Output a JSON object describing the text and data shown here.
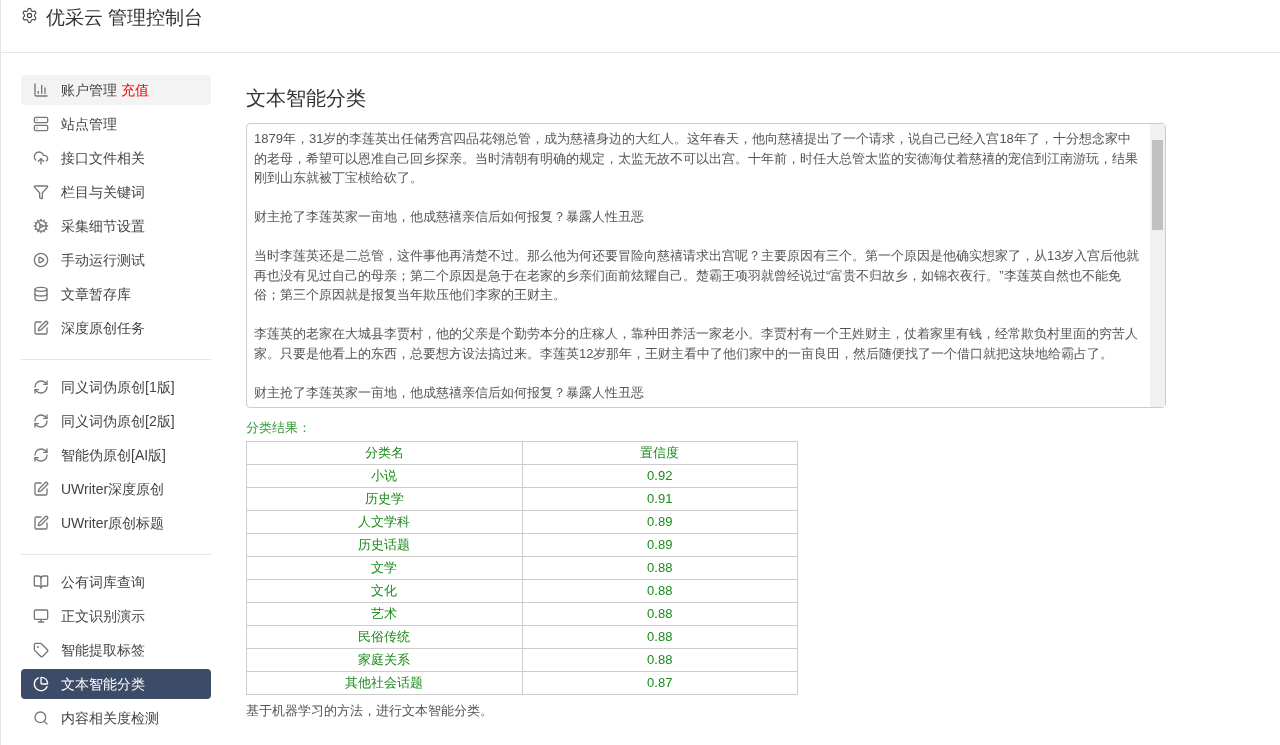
{
  "header": {
    "title": "优采云 管理控制台"
  },
  "sidebar": {
    "groups": [
      {
        "items": [
          {
            "label": "账户管理",
            "badge": "充值",
            "hovered": true,
            "selected": false
          },
          {
            "label": "站点管理",
            "hovered": false,
            "selected": false
          },
          {
            "label": "接口文件相关",
            "hovered": false,
            "selected": false
          },
          {
            "label": "栏目与关键词",
            "hovered": false,
            "selected": false
          },
          {
            "label": "采集细节设置",
            "hovered": false,
            "selected": false
          },
          {
            "label": "手动运行测试",
            "hovered": false,
            "selected": false
          },
          {
            "label": "文章暂存库",
            "hovered": false,
            "selected": false
          },
          {
            "label": "深度原创任务",
            "hovered": false,
            "selected": false
          }
        ]
      },
      {
        "items": [
          {
            "label": "同义词伪原创[1版]",
            "hovered": false,
            "selected": false
          },
          {
            "label": "同义词伪原创[2版]",
            "hovered": false,
            "selected": false
          },
          {
            "label": "智能伪原创[AI版]",
            "hovered": false,
            "selected": false
          },
          {
            "label": "UWriter深度原创",
            "hovered": false,
            "selected": false
          },
          {
            "label": "UWriter原创标题",
            "hovered": false,
            "selected": false
          }
        ]
      },
      {
        "items": [
          {
            "label": "公有词库查询",
            "hovered": false,
            "selected": false
          },
          {
            "label": "正文识别演示",
            "hovered": false,
            "selected": false
          },
          {
            "label": "智能提取标签",
            "hovered": false,
            "selected": false
          },
          {
            "label": "文本智能分类",
            "hovered": false,
            "selected": true
          },
          {
            "label": "内容相关度检测",
            "hovered": false,
            "selected": false
          }
        ]
      }
    ]
  },
  "main": {
    "title": "文本智能分类",
    "text_input": {
      "paragraphs": [
        "1879年，31岁的李莲英出任储秀宫四品花翎总管，成为慈禧身边的大红人。这年春天，他向慈禧提出了一个请求，说自己已经入宫18年了，十分想念家中的老母，希望可以恩准自己回乡探亲。当时清朝有明确的规定，太监无故不可以出宫。十年前，时任大总管太监的安德海仗着慈禧的宠信到江南游玩，结果刚到山东就被丁宝桢给砍了。",
        "财主抢了李莲英家一亩地，他成慈禧亲信后如何报复？暴露人性丑恶",
        "当时李莲英还是二总管，这件事他再清楚不过。那么他为何还要冒险向慈禧请求出宫呢？主要原因有三个。第一个原因是他确实想家了，从13岁入宫后他就再也没有见过自己的母亲；第二个原因是急于在老家的乡亲们面前炫耀自己。楚霸王项羽就曾经说过“富贵不归故乡，如锦衣夜行。”李莲英自然也不能免俗；第三个原因就是报复当年欺压他们李家的王财主。",
        "李莲英的老家在大城县李贾村，他的父亲是个勤劳本分的庄稼人，靠种田养活一家老小。李贾村有一个王姓财主，仗着家里有钱，经常欺负村里面的穷苦人家。只要是他看上的东西，总要想方设法搞过来。李莲英12岁那年，王财主看中了他们家中的一亩良田，然后随便找了一个借口就把这块地给霸占了。",
        "财主抢了李莲英家一亩地，他成慈禧亲信后如何报复？暴露人性丑恶"
      ]
    },
    "result_label": "分类结果：",
    "table": {
      "columns": [
        "分类名",
        "置信度"
      ],
      "rows": [
        [
          "小说",
          "0.92"
        ],
        [
          "历史学",
          "0.91"
        ],
        [
          "人文学科",
          "0.89"
        ],
        [
          "历史话题",
          "0.89"
        ],
        [
          "文学",
          "0.88"
        ],
        [
          "文化",
          "0.88"
        ],
        [
          "艺术",
          "0.88"
        ],
        [
          "民俗传统",
          "0.88"
        ],
        [
          "家庭关系",
          "0.88"
        ],
        [
          "其他社会话题",
          "0.87"
        ]
      ]
    },
    "footnote": "基于机器学习的方法，进行文本智能分类。"
  }
}
